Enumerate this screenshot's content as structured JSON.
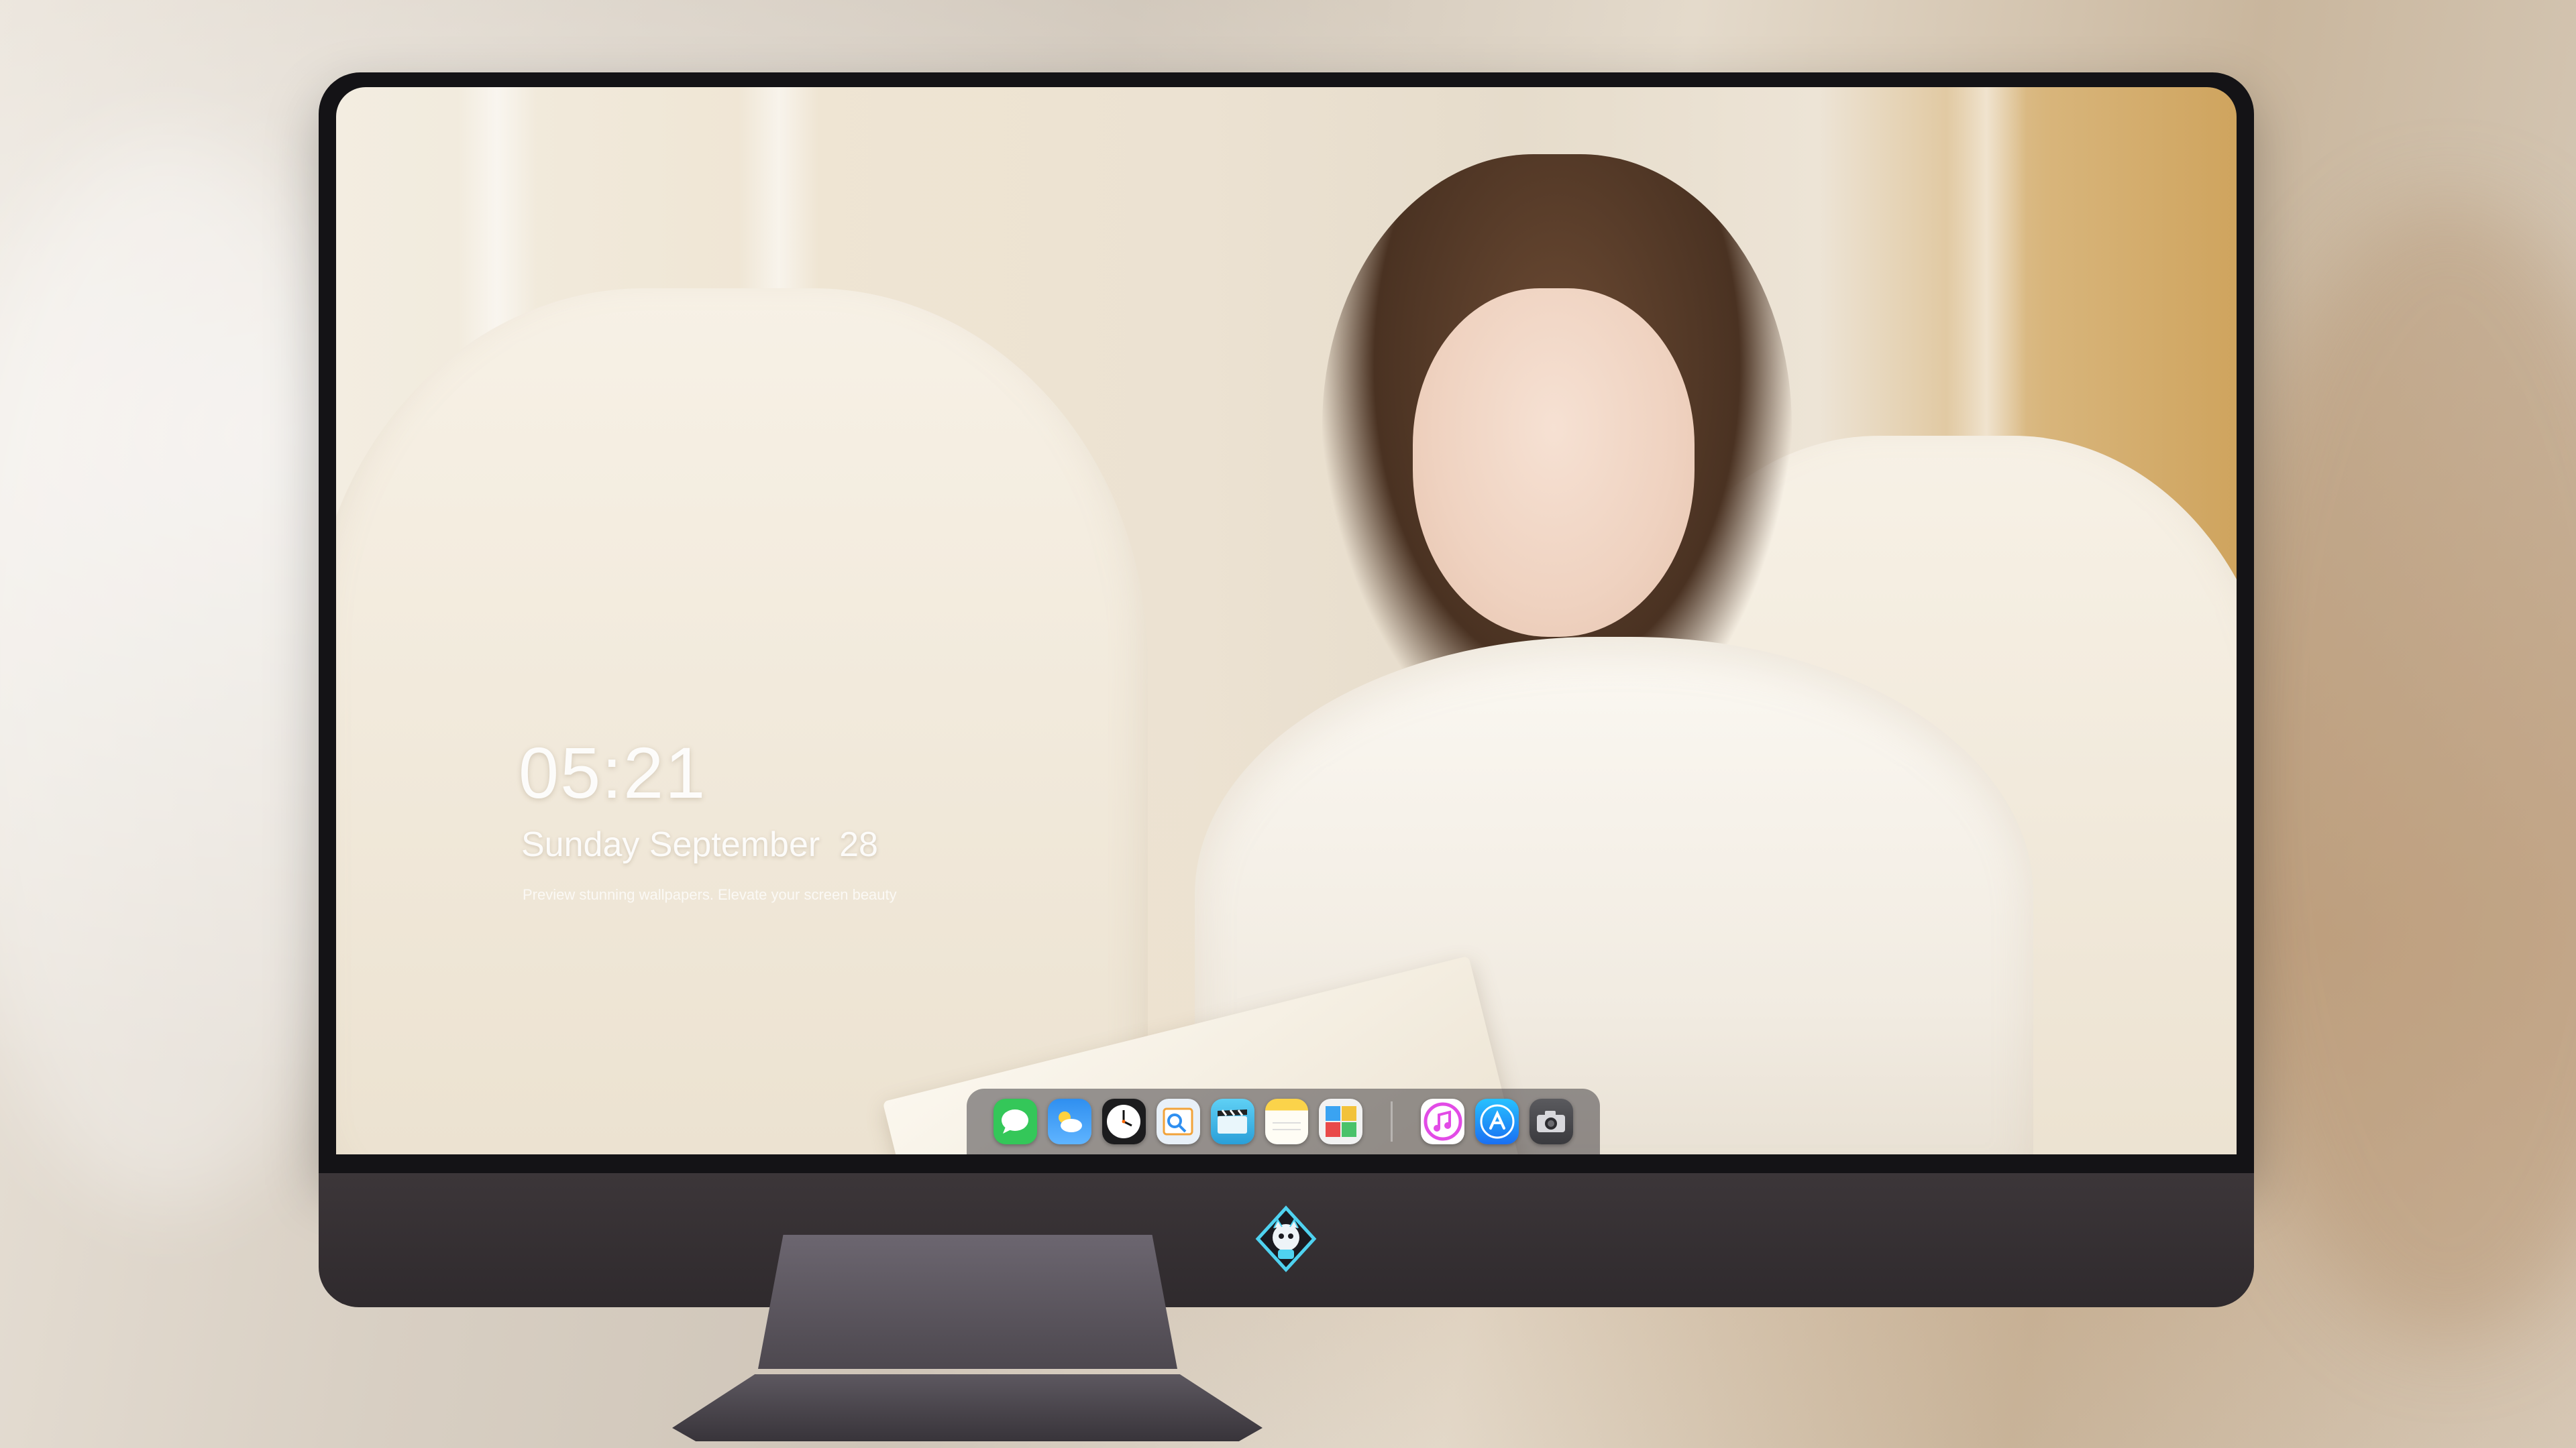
{
  "lockscreen": {
    "time": "05:21",
    "date": "Sunday September  28",
    "tagline": "Preview stunning wallpapers. Elevate your screen beauty"
  },
  "dock": {
    "apps": [
      {
        "name": "messages-icon",
        "color": "#34c759"
      },
      {
        "name": "weather-icon",
        "color": "#2f8ff0"
      },
      {
        "name": "clock-icon",
        "color": "#1c1c1e"
      },
      {
        "name": "preview-icon",
        "color": "#e8f0f8"
      },
      {
        "name": "clips-icon",
        "color": "#3ab6e8"
      },
      {
        "name": "notes-icon",
        "color": "#fbd34a"
      },
      {
        "name": "photo-booth-icon",
        "color": "#f2f2f2"
      },
      {
        "name": "itunes-icon",
        "color": "#e24be6"
      },
      {
        "name": "app-store-icon",
        "color": "#1a8cf2"
      },
      {
        "name": "camera-icon",
        "color": "#4a4a4e"
      }
    ]
  },
  "colors": {
    "bezel": "#141316",
    "chin": "#3c3639",
    "logo_accent": "#4fd2f0"
  }
}
